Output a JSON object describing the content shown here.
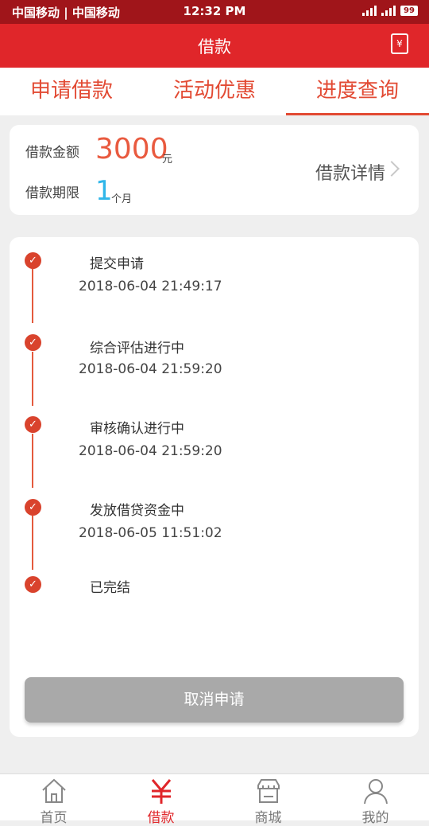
{
  "status_bar": {
    "carrier": "中国移动 | 中国移动",
    "time": "12:32 PM",
    "battery": "99"
  },
  "header": {
    "title": "借款",
    "right_icon": "loan-exchange-icon",
    "right_icon_glyph": "¥"
  },
  "tabs": [
    {
      "label": "申请借款",
      "active": false
    },
    {
      "label": "活动优惠",
      "active": false
    },
    {
      "label": "进度查询",
      "active": true
    }
  ],
  "summary": {
    "amount_label": "借款金额",
    "amount_value": "3000",
    "amount_unit": "元",
    "term_label": "借款期限",
    "term_value": "1",
    "term_unit": "个月",
    "detail_link": "借款详情"
  },
  "timeline": [
    {
      "title": "提交申请",
      "time": "2018-06-04 21:49:17"
    },
    {
      "title": "综合评估进行中",
      "time": "2018-06-04 21:59:20"
    },
    {
      "title": "审核确认进行中",
      "time": "2018-06-04 21:59:20"
    },
    {
      "title": "发放借贷资金中",
      "time": "2018-06-05 11:51:02"
    },
    {
      "title": "已完结",
      "time": ""
    }
  ],
  "cancel_button": "取消申请",
  "bottom_nav": [
    {
      "label": "首页",
      "icon": "home-icon",
      "active": false
    },
    {
      "label": "借款",
      "icon": "yen-icon",
      "active": true
    },
    {
      "label": "商城",
      "icon": "store-icon",
      "active": false
    },
    {
      "label": "我的",
      "icon": "user-icon",
      "active": false
    }
  ],
  "colors": {
    "status_bar": "#a0151a",
    "header": "#e0262a",
    "accent_red": "#e24a33",
    "amount": "#e95a3f",
    "term": "#2fb6e9",
    "timeline": "#d9432d",
    "button_disabled": "#a9a9a9"
  }
}
